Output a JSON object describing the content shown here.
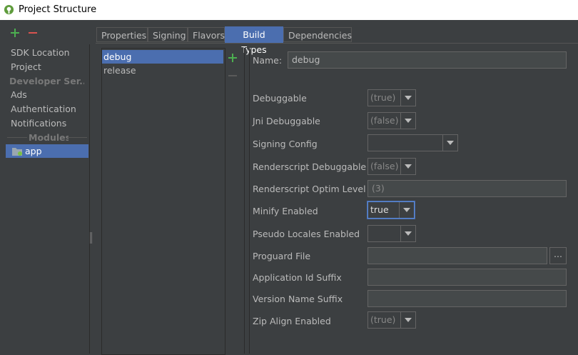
{
  "window": {
    "title": "Project Structure"
  },
  "toolbar": {
    "add_icon": "plus-icon",
    "remove_icon": "minus-icon"
  },
  "sidebar": {
    "items": [
      {
        "label": "SDK Location"
      },
      {
        "label": "Project"
      },
      {
        "label": "Developer Ser..."
      },
      {
        "label": "Ads"
      },
      {
        "label": "Authentication"
      },
      {
        "label": "Notifications"
      },
      {
        "label": "Modules"
      },
      {
        "label": "app"
      }
    ]
  },
  "tabs": [
    {
      "label": "Properties"
    },
    {
      "label": "Signing"
    },
    {
      "label": "Flavors"
    },
    {
      "label": "Build Types"
    },
    {
      "label": "Dependencies"
    }
  ],
  "build_types": [
    {
      "label": "debug"
    },
    {
      "label": "release"
    }
  ],
  "form": {
    "name_label": "Name:",
    "name_value": "debug",
    "fields": [
      {
        "label": "Debuggable",
        "value": "(true)"
      },
      {
        "label": "Jni Debuggable",
        "value": "(false)"
      },
      {
        "label": "Signing Config",
        "value": ""
      },
      {
        "label": "Renderscript Debuggable",
        "value": "(false)"
      },
      {
        "label": "Renderscript Optim Level",
        "value": "(3)"
      },
      {
        "label": "Minify Enabled",
        "value": "true"
      },
      {
        "label": "Pseudo Locales Enabled",
        "value": ""
      },
      {
        "label": "Proguard File",
        "value": "",
        "button": "..."
      },
      {
        "label": "Application Id Suffix",
        "value": ""
      },
      {
        "label": "Version Name Suffix",
        "value": ""
      },
      {
        "label": "Zip Align Enabled",
        "value": "(true)"
      }
    ]
  },
  "colors": {
    "accent": "#4b6eaf",
    "add_green": "#4caf50",
    "remove_red": "#d9534f",
    "logo_green": "#5f9c3c"
  }
}
